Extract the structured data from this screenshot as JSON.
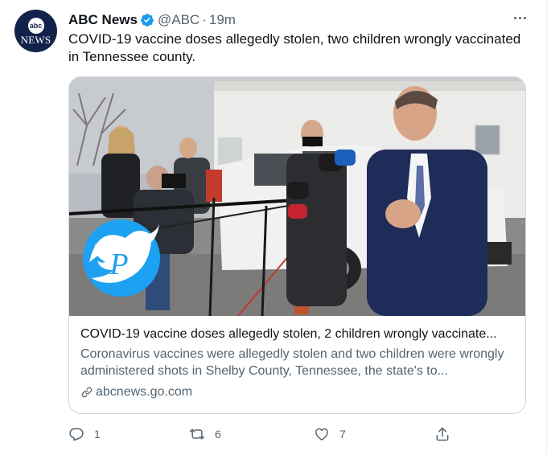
{
  "account": {
    "name": "ABC News",
    "handle": "@ABC",
    "separator": "·",
    "time": "19m",
    "avatar_top": "abc",
    "avatar_bottom": "NEWS",
    "verified_color": "#1d9bf0"
  },
  "tweet": {
    "text": "COVID-19 vaccine doses allegedly stolen, two children wrongly vaccinated in Tennessee county."
  },
  "card": {
    "title": "COVID-19 vaccine doses allegedly stolen, 2 children wrongly vaccinate...",
    "description": "Coronavirus vaccines were allegedly stolen and two children were wrongly administered shots in Shelby County, Tennessee, the state's to...",
    "domain": "abcnews.go.com"
  },
  "actions": {
    "reply_count": "1",
    "retweet_count": "6",
    "like_count": "7"
  },
  "icons": {
    "more": "more-icon",
    "reply": "reply-icon",
    "retweet": "retweet-icon",
    "like": "heart-icon",
    "share": "share-icon",
    "link": "link-icon",
    "verified": "verified-badge-icon",
    "watermark": "twitter-bird-icon"
  },
  "colors": {
    "text_primary": "#0f1419",
    "text_secondary": "#536471",
    "border": "#cfd9de",
    "watermark_blue": "#1da1f2"
  }
}
